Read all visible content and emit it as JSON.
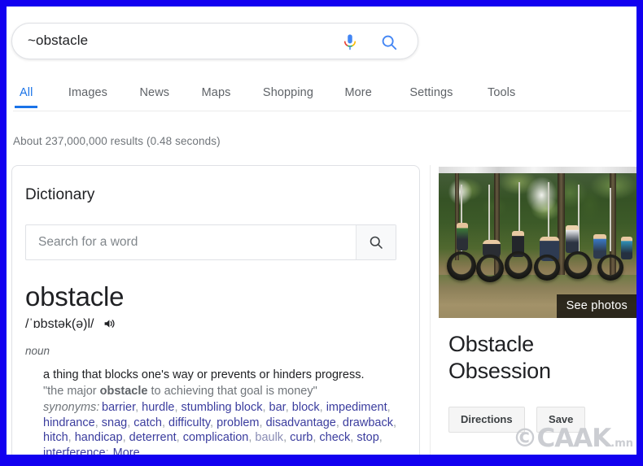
{
  "frame": {
    "border_color": "#1200f0"
  },
  "search": {
    "query": "~obstacle",
    "mic_icon": "microphone-icon",
    "submit_icon": "search-icon"
  },
  "tabs": [
    {
      "label": "All",
      "active": true
    },
    {
      "label": "Images",
      "active": false
    },
    {
      "label": "News",
      "active": false
    },
    {
      "label": "Maps",
      "active": false
    },
    {
      "label": "Shopping",
      "active": false
    },
    {
      "label": "More",
      "active": false
    },
    {
      "label": "Settings",
      "active": false
    },
    {
      "label": "Tools",
      "active": false
    }
  ],
  "result_stats": "About 237,000,000 results (0.48 seconds)",
  "dictionary": {
    "title": "Dictionary",
    "search_placeholder": "Search for a word",
    "search_value": "",
    "search_icon": "search-icon",
    "word": "obstacle",
    "phonetic": "/ˈɒbstək(ə)l/",
    "speaker_icon": "speaker-icon",
    "part_of_speech": "noun",
    "definition": "a thing that blocks one's way or prevents or hinders progress.",
    "example_prefix": "\"the major ",
    "example_bold": "obstacle",
    "example_suffix": " to achieving that goal is money\"",
    "synonyms_label": "synonyms:",
    "synonyms": [
      "barrier",
      "hurdle",
      "stumbling block",
      "bar",
      "block",
      "impediment",
      "hindrance",
      "snag",
      "catch",
      "difficulty",
      "problem",
      "disadvantage",
      "drawback",
      "hitch",
      "handicap",
      "deterrent",
      "complication",
      "baulk",
      "curb",
      "check",
      "stop",
      "interference"
    ],
    "more_label": "More"
  },
  "knowledge_panel": {
    "image_alt": "children-on-tire-swings-photo",
    "see_photos_label": "See photos",
    "title": "Obstacle Obsession",
    "buttons": [
      {
        "label": "Directions"
      },
      {
        "label": "Save"
      }
    ]
  },
  "watermark": {
    "brand": "CAAK",
    "suffix": ".mn",
    "symbol": "©"
  },
  "colors": {
    "accent_blue": "#1a73e8",
    "link_blue": "#1a0dab",
    "synonym_blue": "#3b3d9e",
    "text_primary": "#202124",
    "text_secondary": "#70757a",
    "frame_blue": "#1200f0"
  }
}
